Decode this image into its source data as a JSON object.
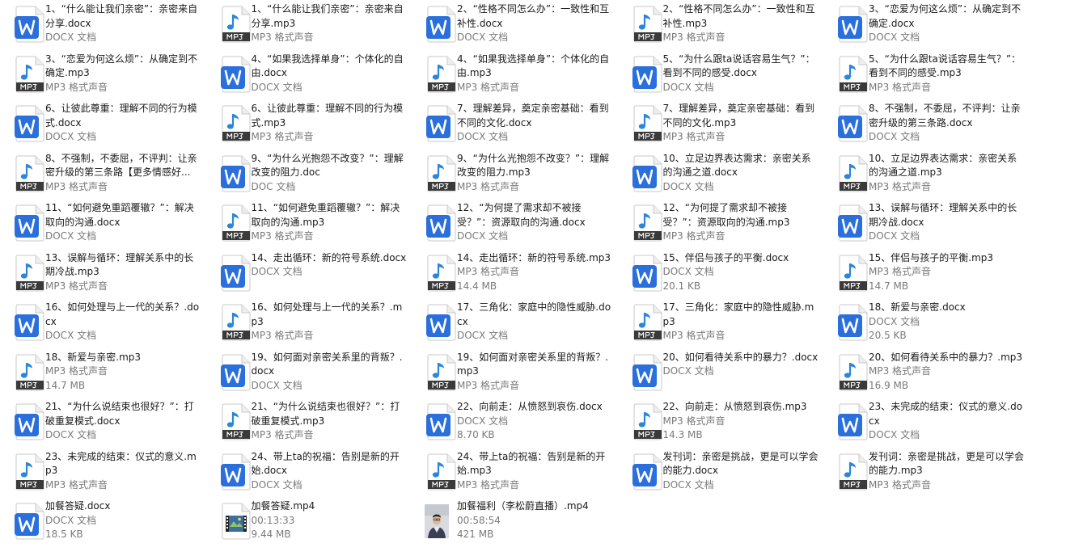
{
  "colors": {
    "docx_blue": "#2a6fdb",
    "mp3_blue": "#2b86d9",
    "text": "#1a1a1a",
    "meta": "#7a7a7a"
  },
  "icon_names": {
    "docx": "word-document-icon",
    "doc": "word-document-icon",
    "mp3": "mp3-audio-file-icon",
    "mp4": "video-file-icon",
    "mp4-photo": "video-thumbnail"
  },
  "files": [
    {
      "type": "docx",
      "name": "1、“什么能让我们亲密”：亲密来自分享.docx",
      "meta": [
        "DOCX 文档"
      ]
    },
    {
      "type": "mp3",
      "name": "1、“什么能让我们亲密”：亲密来自分享.mp3",
      "meta": [
        "MP3 格式声音"
      ]
    },
    {
      "type": "docx",
      "name": "2、“性格不同怎么办”：一致性和互补性.docx",
      "meta": [
        "DOCX 文档"
      ]
    },
    {
      "type": "mp3",
      "name": "2、“性格不同怎么办”：一致性和互补性.mp3",
      "meta": [
        "MP3 格式声音"
      ]
    },
    {
      "type": "docx",
      "name": "3、“恋爱为何这么烦”：从确定到不确定.docx",
      "meta": [
        "DOCX 文档"
      ]
    },
    {
      "type": "mp3",
      "name": "3、“恋爱为何这么烦”：从确定到不确定.mp3",
      "meta": [
        "MP3 格式声音"
      ]
    },
    {
      "type": "docx",
      "name": "4、“如果我选择单身”：个体化的自由.docx",
      "meta": [
        "DOCX 文档"
      ]
    },
    {
      "type": "mp3",
      "name": "4、“如果我选择单身”：个体化的自由.mp3",
      "meta": [
        "MP3 格式声音"
      ]
    },
    {
      "type": "docx",
      "name": "5、“为什么跟ta说话容易生气？”：看到不同的感受.docx",
      "meta": [
        "DOCX 文档"
      ]
    },
    {
      "type": "mp3",
      "name": "5、“为什么跟ta说话容易生气？”：看到不同的感受.mp3",
      "meta": [
        "MP3 格式声音"
      ]
    },
    {
      "type": "docx",
      "name": "6、让彼此尊重：理解不同的行为模式.docx",
      "meta": [
        "DOCX 文档"
      ]
    },
    {
      "type": "mp3",
      "name": "6、让彼此尊重：理解不同的行为模式.mp3",
      "meta": [
        "MP3 格式声音"
      ]
    },
    {
      "type": "docx",
      "name": "7、理解差异，奠定亲密基础：看到不同的文化.docx",
      "meta": [
        "DOCX 文档"
      ]
    },
    {
      "type": "mp3",
      "name": "7、理解差异，奠定亲密基础：看到不同的文化.mp3",
      "meta": [
        "MP3 格式声音"
      ]
    },
    {
      "type": "docx",
      "name": "8、不强制，不委屈，不评判：让亲密升级的第三条路.docx",
      "meta": [
        "DOCX 文档"
      ]
    },
    {
      "type": "mp3",
      "name": "8、不强制，不委屈，不评判：让亲密升级的第三条路【更多情感好...",
      "meta": [
        "MP3 格式声音"
      ]
    },
    {
      "type": "doc",
      "name": "9、“为什么光抱怨不改变？”：理解改变的阻力.doc",
      "meta": [
        "DOC 文档"
      ]
    },
    {
      "type": "mp3",
      "name": "9、“为什么光抱怨不改变？”：理解改变的阻力.mp3",
      "meta": [
        "MP3 格式声音"
      ]
    },
    {
      "type": "docx",
      "name": "10、立足边界表达需求：亲密关系的沟通之道.docx",
      "meta": [
        "DOCX 文档"
      ]
    },
    {
      "type": "mp3",
      "name": "10、立足边界表达需求：亲密关系的沟通之道.mp3",
      "meta": [
        "MP3 格式声音"
      ]
    },
    {
      "type": "docx",
      "name": "11、“如何避免重蹈覆辙？”：解决取向的沟通.docx",
      "meta": [
        "DOCX 文档"
      ]
    },
    {
      "type": "mp3",
      "name": "11、“如何避免重蹈覆辙？”：解决取向的沟通.mp3",
      "meta": [
        "MP3 格式声音"
      ]
    },
    {
      "type": "docx",
      "name": "12、“为何提了需求却不被接受？”：资源取向的沟通.docx",
      "meta": [
        "DOCX 文档"
      ]
    },
    {
      "type": "mp3",
      "name": "12、“为何提了需求却不被接受？”：资源取向的沟通.mp3",
      "meta": [
        "MP3 格式声音"
      ]
    },
    {
      "type": "docx",
      "name": "13、误解与循环：理解关系中的长期冷战.docx",
      "meta": [
        "DOCX 文档"
      ]
    },
    {
      "type": "mp3",
      "name": "13、误解与循环：理解关系中的长期冷战.mp3",
      "meta": [
        "MP3 格式声音"
      ]
    },
    {
      "type": "docx",
      "name": "14、走出循环：新的符号系统.docx",
      "meta": [
        "DOCX 文档"
      ]
    },
    {
      "type": "mp3",
      "name": "14、走出循环：新的符号系统.mp3",
      "meta": [
        "MP3 格式声音",
        "14.4 MB"
      ]
    },
    {
      "type": "docx",
      "name": "15、伴侣与孩子的平衡.docx",
      "meta": [
        "DOCX 文档",
        "20.1 KB"
      ]
    },
    {
      "type": "mp3",
      "name": "15、伴侣与孩子的平衡.mp3",
      "meta": [
        "MP3 格式声音",
        "14.7 MB"
      ]
    },
    {
      "type": "docx",
      "name": "16、如何处理与上一代的关系？.docx",
      "meta": [
        "DOCX 文档"
      ]
    },
    {
      "type": "mp3",
      "name": "16、如何处理与上一代的关系？.mp3",
      "meta": [
        "MP3 格式声音"
      ]
    },
    {
      "type": "docx",
      "name": "17、三角化：家庭中的隐性威胁.docx",
      "meta": [
        "DOCX 文档"
      ]
    },
    {
      "type": "mp3",
      "name": "17、三角化：家庭中的隐性威胁.mp3",
      "meta": [
        "MP3 格式声音"
      ]
    },
    {
      "type": "docx",
      "name": "18、新爱与亲密.docx",
      "meta": [
        "DOCX 文档",
        "20.5 KB"
      ]
    },
    {
      "type": "mp3",
      "name": "18、新爱与亲密.mp3",
      "meta": [
        "MP3 格式声音",
        "14.7 MB"
      ]
    },
    {
      "type": "docx",
      "name": "19、如何面对亲密关系里的背叛？.docx",
      "meta": [
        "DOCX 文档"
      ]
    },
    {
      "type": "mp3",
      "name": "19、如何面对亲密关系里的背叛？.mp3",
      "meta": [
        "MP3 格式声音"
      ]
    },
    {
      "type": "docx",
      "name": "20、如何看待关系中的暴力？.docx",
      "meta": [
        "DOCX 文档"
      ]
    },
    {
      "type": "mp3",
      "name": "20、如何看待关系中的暴力？.mp3",
      "meta": [
        "MP3 格式声音",
        "16.9 MB"
      ]
    },
    {
      "type": "docx",
      "name": "21、“为什么说结束也很好？”：打破重复模式.docx",
      "meta": [
        "DOCX 文档"
      ]
    },
    {
      "type": "mp3",
      "name": "21、“为什么说结束也很好？”：打破重复模式.mp3",
      "meta": [
        "MP3 格式声音"
      ]
    },
    {
      "type": "docx",
      "name": "22、向前走：从愤怒到哀伤.docx",
      "meta": [
        "DOCX 文档",
        "8.70 KB"
      ]
    },
    {
      "type": "mp3",
      "name": "22、向前走：从愤怒到哀伤.mp3",
      "meta": [
        "MP3 格式声音",
        "14.3 MB"
      ]
    },
    {
      "type": "docx",
      "name": "23、未完成的结束：仪式的意义.docx",
      "meta": [
        "DOCX 文档"
      ]
    },
    {
      "type": "mp3",
      "name": "23、未完成的结束：仪式的意义.mp3",
      "meta": [
        "MP3 格式声音"
      ]
    },
    {
      "type": "docx",
      "name": "24、带上ta的祝福：告别是新的开始.docx",
      "meta": [
        "DOCX 文档"
      ]
    },
    {
      "type": "mp3",
      "name": "24、带上ta的祝福：告别是新的开始.mp3",
      "meta": [
        "MP3 格式声音"
      ]
    },
    {
      "type": "docx",
      "name": "发刊词：亲密是挑战，更是可以学会的能力.docx",
      "meta": [
        "DOCX 文档"
      ]
    },
    {
      "type": "mp3",
      "name": "发刊词：亲密是挑战，更是可以学会的能力.mp3",
      "meta": [
        "MP3 格式声音"
      ]
    },
    {
      "type": "docx",
      "name": "加餐答疑.docx",
      "meta": [
        "DOCX 文档",
        "18.5 KB"
      ]
    },
    {
      "type": "mp4",
      "name": "加餐答疑.mp4",
      "meta": [
        "00:13:33",
        "9.44 MB"
      ]
    },
    {
      "type": "mp4-photo",
      "name": "加餐福利（李松蔚直播）.mp4",
      "meta": [
        "00:58:54",
        "421 MB"
      ]
    }
  ]
}
